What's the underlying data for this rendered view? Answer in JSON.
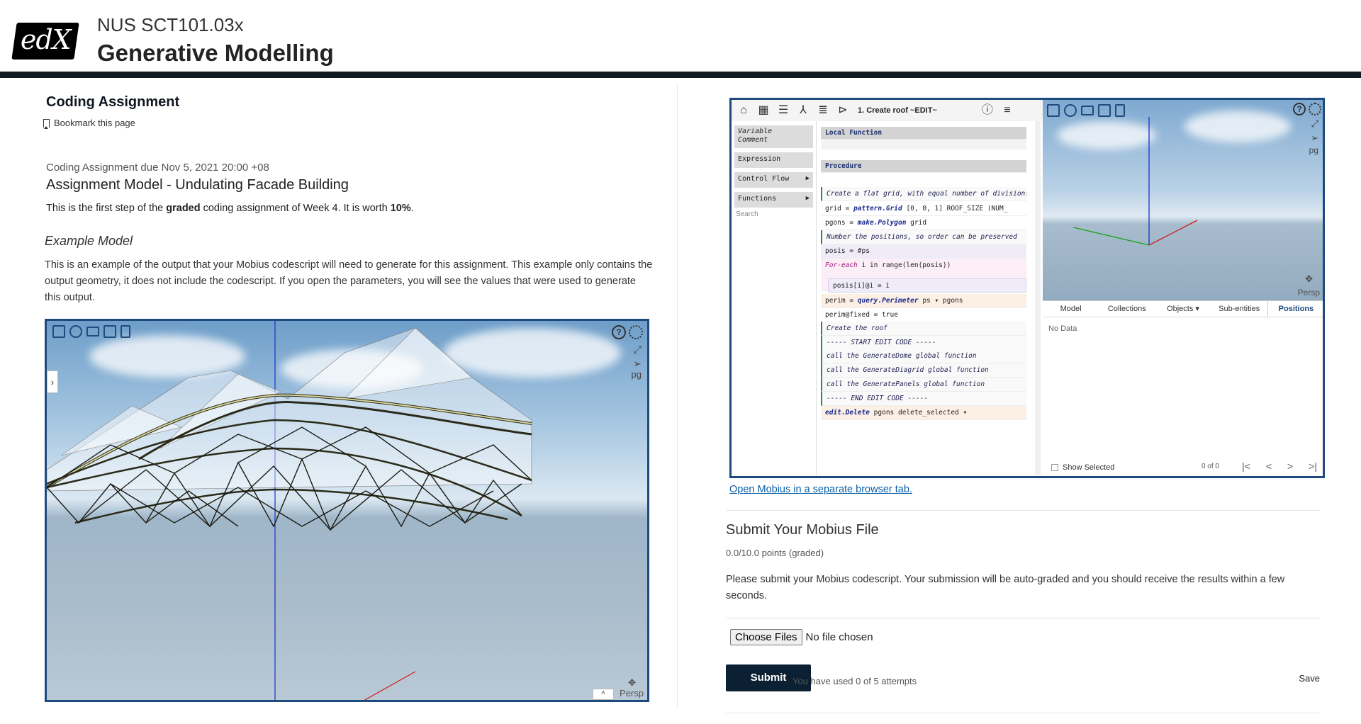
{
  "header": {
    "logo": "edX",
    "course_code": "NUS SCT101.03x",
    "course_title": "Generative Modelling"
  },
  "left": {
    "page_heading": "Coding Assignment",
    "bookmark": "Bookmark this page",
    "due": "Coding Assignment due Nov 5, 2021 20:00 +08",
    "assignment_title": "Assignment Model - Undulating Facade Building",
    "intro_prefix": "This is the first step of the ",
    "intro_bold": "graded",
    "intro_mid": " coding assignment of Week 4. It is worth ",
    "intro_worth": "10%",
    "intro_suffix": ".",
    "example_heading": "Example Model",
    "example_text": "This is an example of the output that your Mobius codescript will need to generate for this assignment. This example only contains the output geometry, it does not include the codescript. If you open the parameters, you will see the values that were used to generate this output.",
    "viewer": {
      "pg": "pg",
      "persp": "Persp",
      "help": "?",
      "handle": "›",
      "collapse": "^"
    }
  },
  "mobius": {
    "procedure_name": "1. Create roof ~EDIT~",
    "sidebar": {
      "variable": "Variable",
      "comment": "Comment",
      "expression": "Expression",
      "control_flow": "Control Flow",
      "functions": "Functions",
      "search": "Search"
    },
    "code": {
      "local_function": "Local Function",
      "procedure": "Procedure",
      "c1": "Create a flat grid, with equal number of divisions",
      "grid_var": "grid",
      "grid_fn": "pattern.Grid",
      "grid_args": "[0, 0, 1] ROOF_SIZE (NUM_",
      "pgons_var": "pgons",
      "pgons_fn": "make.Polygon",
      "pgons_args": "grid",
      "c2": "Number the positions, so order can be preserved",
      "posis_line": "posis = #ps",
      "foreach_kw": "For-each",
      "foreach_rest": "i in range(len(posis))",
      "posis_i": "posis[i]@i = i",
      "perim_var": "perim",
      "perim_fn": "query.Perimeter",
      "perim_args": "ps ▾ pgons",
      "perim_fixed": "perim@fixed = true",
      "c3": "Create the roof",
      "c4": "----- START EDIT CODE -----",
      "c5": "call the GenerateDome global function",
      "c6": "call the GenerateDiagrid global function",
      "c7": "call the GeneratePanels global function",
      "c8": "----- END EDIT CODE -----",
      "delete_fn": "edit.Delete",
      "delete_args": "pgons delete_selected ▾"
    },
    "viewer": {
      "pg": "pg",
      "persp": "Persp",
      "help": "?"
    },
    "tabs": [
      "Model",
      "Collections",
      "Objects ▾",
      "Sub-entities",
      "Positions"
    ],
    "active_tab": "Positions",
    "table": {
      "no_data": "No Data",
      "show_selected": "Show Selected",
      "count": "0 of 0"
    }
  },
  "right": {
    "open_link": "Open Mobius in a separate browser tab.",
    "submit_heading": "Submit Your Mobius File",
    "points": "0.0/10.0 points (graded)",
    "submit_text": "Please submit your Mobius codescript. Your submission will be auto-graded and you should receive the results within a few seconds.",
    "choose_files": "Choose Files",
    "no_file": "No file chosen",
    "submit": "Submit",
    "attempts": "You have used 0 of 5 attempts",
    "save": "Save"
  },
  "colors": {
    "brand_dark": "#101820",
    "viewer_border": "#1e4a7e",
    "link": "#0a5fa8"
  }
}
